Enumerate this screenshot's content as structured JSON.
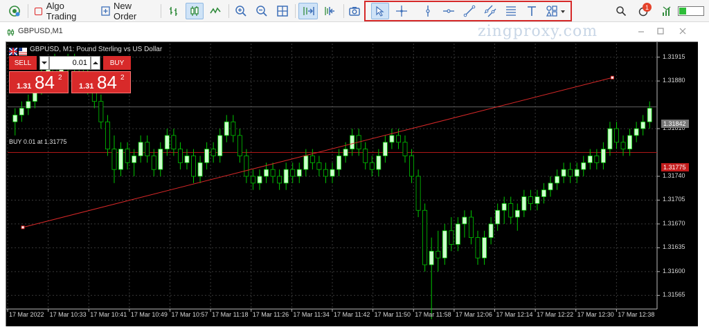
{
  "toolbar": {
    "algo_trading_label": "Algo Trading",
    "new_order_label": "New Order",
    "notification_count": "1"
  },
  "window": {
    "tab_title": "GBPUSD,M1",
    "watermark": "zingproxy.com"
  },
  "chart": {
    "info_label": "GBPUSD, M1:  Pound Sterling vs US Dollar",
    "symbol": "GBPUSD",
    "timeframe": "M1",
    "position_line_label": "BUY 0.01 at 1.31775",
    "current_price_label": "1.31842",
    "position_price_label": "1.31775",
    "bid_color": "#d82a2a",
    "line_color": "#d62828",
    "bull_candle_color": "#ccffcc",
    "wick_color": "#00c800"
  },
  "one_click": {
    "sell_label": "SELL",
    "buy_label": "BUY",
    "volume": "0.01",
    "sell_price_small": "1.31",
    "sell_price_large": "84",
    "sell_price_sup": "2",
    "buy_price_small": "1.31",
    "buy_price_large": "84",
    "buy_price_sup": "2"
  },
  "price_axis": [
    "1.31915",
    "1.31880",
    "1.31810",
    "1.31740",
    "1.31705",
    "1.31670",
    "1.31635",
    "1.31600",
    "1.31565"
  ],
  "time_axis": [
    "17 Mar 2022",
    "17 Mar 10:33",
    "17 Mar 10:41",
    "17 Mar 10:49",
    "17 Mar 10:57",
    "17 Mar 11:18",
    "17 Mar 11:26",
    "17 Mar 11:34",
    "17 Mar 11:42",
    "17 Mar 11:50",
    "17 Mar 11:58",
    "17 Mar 12:06",
    "17 Mar 12:14",
    "17 Mar 12:22",
    "17 Mar 12:30",
    "17 Mar 12:38"
  ],
  "chart_data": {
    "type": "candlestick",
    "ylim": [
      1.31545,
      1.31935
    ],
    "candles": [
      [
        1.3182,
        1.3184,
        1.318,
        1.3183
      ],
      [
        1.3183,
        1.3185,
        1.3182,
        1.3184
      ],
      [
        1.3184,
        1.3186,
        1.3183,
        1.3185
      ],
      [
        1.3185,
        1.3189,
        1.3184,
        1.3188
      ],
      [
        1.3188,
        1.319,
        1.3186,
        1.3189
      ],
      [
        1.3189,
        1.3191,
        1.3187,
        1.319
      ],
      [
        1.319,
        1.3192,
        1.3188,
        1.3189
      ],
      [
        1.3189,
        1.3191,
        1.3187,
        1.319
      ],
      [
        1.319,
        1.3192,
        1.3188,
        1.3191
      ],
      [
        1.3191,
        1.3192,
        1.3189,
        1.319
      ],
      [
        1.319,
        1.3191,
        1.3188,
        1.3189
      ],
      [
        1.3189,
        1.319,
        1.3186,
        1.3187
      ],
      [
        1.3187,
        1.3188,
        1.3184,
        1.3185
      ],
      [
        1.3185,
        1.3186,
        1.3181,
        1.3182
      ],
      [
        1.3182,
        1.3183,
        1.3177,
        1.3178
      ],
      [
        1.3178,
        1.318,
        1.3173,
        1.3175
      ],
      [
        1.3175,
        1.3179,
        1.3174,
        1.3178
      ],
      [
        1.3178,
        1.3179,
        1.3175,
        1.3176
      ],
      [
        1.3176,
        1.3178,
        1.3174,
        1.3177
      ],
      [
        1.3177,
        1.318,
        1.3176,
        1.3179
      ],
      [
        1.3179,
        1.318,
        1.3176,
        1.3177
      ],
      [
        1.3177,
        1.3178,
        1.3174,
        1.3175
      ],
      [
        1.3175,
        1.3179,
        1.3174,
        1.3178
      ],
      [
        1.3178,
        1.3181,
        1.3177,
        1.318
      ],
      [
        1.318,
        1.3181,
        1.3177,
        1.3178
      ],
      [
        1.3178,
        1.3179,
        1.3175,
        1.3176
      ],
      [
        1.3176,
        1.3178,
        1.3175,
        1.3177
      ],
      [
        1.3177,
        1.3178,
        1.3173,
        1.3174
      ],
      [
        1.3174,
        1.3177,
        1.3173,
        1.3176
      ],
      [
        1.3176,
        1.3179,
        1.3175,
        1.3178
      ],
      [
        1.3178,
        1.3179,
        1.3176,
        1.3177
      ],
      [
        1.3177,
        1.3181,
        1.3176,
        1.318
      ],
      [
        1.318,
        1.3183,
        1.3179,
        1.3182
      ],
      [
        1.3182,
        1.3183,
        1.3179,
        1.318
      ],
      [
        1.318,
        1.3181,
        1.3176,
        1.3177
      ],
      [
        1.3177,
        1.3178,
        1.3173,
        1.3174
      ],
      [
        1.3174,
        1.3175,
        1.3172,
        1.3173
      ],
      [
        1.3173,
        1.3175,
        1.3172,
        1.3174
      ],
      [
        1.3174,
        1.3176,
        1.3173,
        1.3175
      ],
      [
        1.3175,
        1.3176,
        1.3173,
        1.3174
      ],
      [
        1.3174,
        1.3175,
        1.3172,
        1.3173
      ],
      [
        1.3173,
        1.3176,
        1.3172,
        1.3175
      ],
      [
        1.3175,
        1.3176,
        1.3173,
        1.3174
      ],
      [
        1.3174,
        1.3176,
        1.3173,
        1.3175
      ],
      [
        1.3175,
        1.3178,
        1.3174,
        1.3177
      ],
      [
        1.3177,
        1.3178,
        1.3175,
        1.3176
      ],
      [
        1.3176,
        1.3177,
        1.3174,
        1.3175
      ],
      [
        1.3175,
        1.3176,
        1.3173,
        1.3174
      ],
      [
        1.3174,
        1.3176,
        1.3173,
        1.3175
      ],
      [
        1.3175,
        1.3178,
        1.3174,
        1.3177
      ],
      [
        1.3177,
        1.3179,
        1.3176,
        1.3178
      ],
      [
        1.3178,
        1.3181,
        1.3177,
        1.318
      ],
      [
        1.318,
        1.3181,
        1.3177,
        1.3178
      ],
      [
        1.3178,
        1.3179,
        1.3175,
        1.3176
      ],
      [
        1.3176,
        1.3177,
        1.3174,
        1.3175
      ],
      [
        1.3175,
        1.3178,
        1.3174,
        1.3177
      ],
      [
        1.3177,
        1.318,
        1.3176,
        1.3179
      ],
      [
        1.3179,
        1.3181,
        1.3178,
        1.318
      ],
      [
        1.318,
        1.3181,
        1.3178,
        1.3179
      ],
      [
        1.3179,
        1.318,
        1.3176,
        1.3177
      ],
      [
        1.3177,
        1.3178,
        1.3173,
        1.3174
      ],
      [
        1.3174,
        1.3175,
        1.3168,
        1.3169
      ],
      [
        1.3169,
        1.317,
        1.316,
        1.3161
      ],
      [
        1.3161,
        1.3165,
        1.3153,
        1.3163
      ],
      [
        1.3163,
        1.3166,
        1.316,
        1.3162
      ],
      [
        1.3162,
        1.3167,
        1.3161,
        1.3166
      ],
      [
        1.3166,
        1.3168,
        1.3163,
        1.3164
      ],
      [
        1.3164,
        1.3168,
        1.3163,
        1.3167
      ],
      [
        1.3167,
        1.3169,
        1.3165,
        1.3168
      ],
      [
        1.3168,
        1.3169,
        1.3164,
        1.3165
      ],
      [
        1.3165,
        1.3166,
        1.3161,
        1.3162
      ],
      [
        1.3162,
        1.3166,
        1.3161,
        1.3165
      ],
      [
        1.3165,
        1.3168,
        1.3164,
        1.3167
      ],
      [
        1.3167,
        1.317,
        1.3166,
        1.3169
      ],
      [
        1.3169,
        1.3171,
        1.3167,
        1.317
      ],
      [
        1.317,
        1.3171,
        1.3167,
        1.3168
      ],
      [
        1.3168,
        1.317,
        1.3166,
        1.3169
      ],
      [
        1.3169,
        1.3172,
        1.3168,
        1.3171
      ],
      [
        1.3171,
        1.3172,
        1.3169,
        1.317
      ],
      [
        1.317,
        1.3172,
        1.3169,
        1.3171
      ],
      [
        1.3171,
        1.3173,
        1.317,
        1.3172
      ],
      [
        1.3172,
        1.3174,
        1.3171,
        1.3173
      ],
      [
        1.3173,
        1.3175,
        1.3172,
        1.3174
      ],
      [
        1.3174,
        1.3176,
        1.3173,
        1.3175
      ],
      [
        1.3175,
        1.3176,
        1.3173,
        1.3174
      ],
      [
        1.3174,
        1.3176,
        1.3173,
        1.3175
      ],
      [
        1.3175,
        1.3177,
        1.3174,
        1.3176
      ],
      [
        1.3176,
        1.3178,
        1.3175,
        1.3177
      ],
      [
        1.3177,
        1.3178,
        1.3175,
        1.3176
      ],
      [
        1.3176,
        1.3179,
        1.3175,
        1.3178
      ],
      [
        1.3178,
        1.3182,
        1.3177,
        1.3181
      ],
      [
        1.3181,
        1.3182,
        1.3178,
        1.3179
      ],
      [
        1.3179,
        1.318,
        1.3177,
        1.3178
      ],
      [
        1.3178,
        1.3181,
        1.3177,
        1.318
      ],
      [
        1.318,
        1.3182,
        1.3179,
        1.3181
      ],
      [
        1.3181,
        1.3183,
        1.318,
        1.3182
      ],
      [
        1.3182,
        1.3185,
        1.3181,
        1.3184
      ]
    ],
    "lines": [
      {
        "from": [
          "17 Mar 2022",
          1.31665
        ],
        "to": [
          "17 Mar 12:38",
          1.31885
        ],
        "color": "#d62828"
      },
      {
        "level": 1.31775,
        "color": "#b01818",
        "label": "BUY 0.01 at 1.31775"
      },
      {
        "level": 1.31842,
        "color": "#606060"
      }
    ]
  }
}
